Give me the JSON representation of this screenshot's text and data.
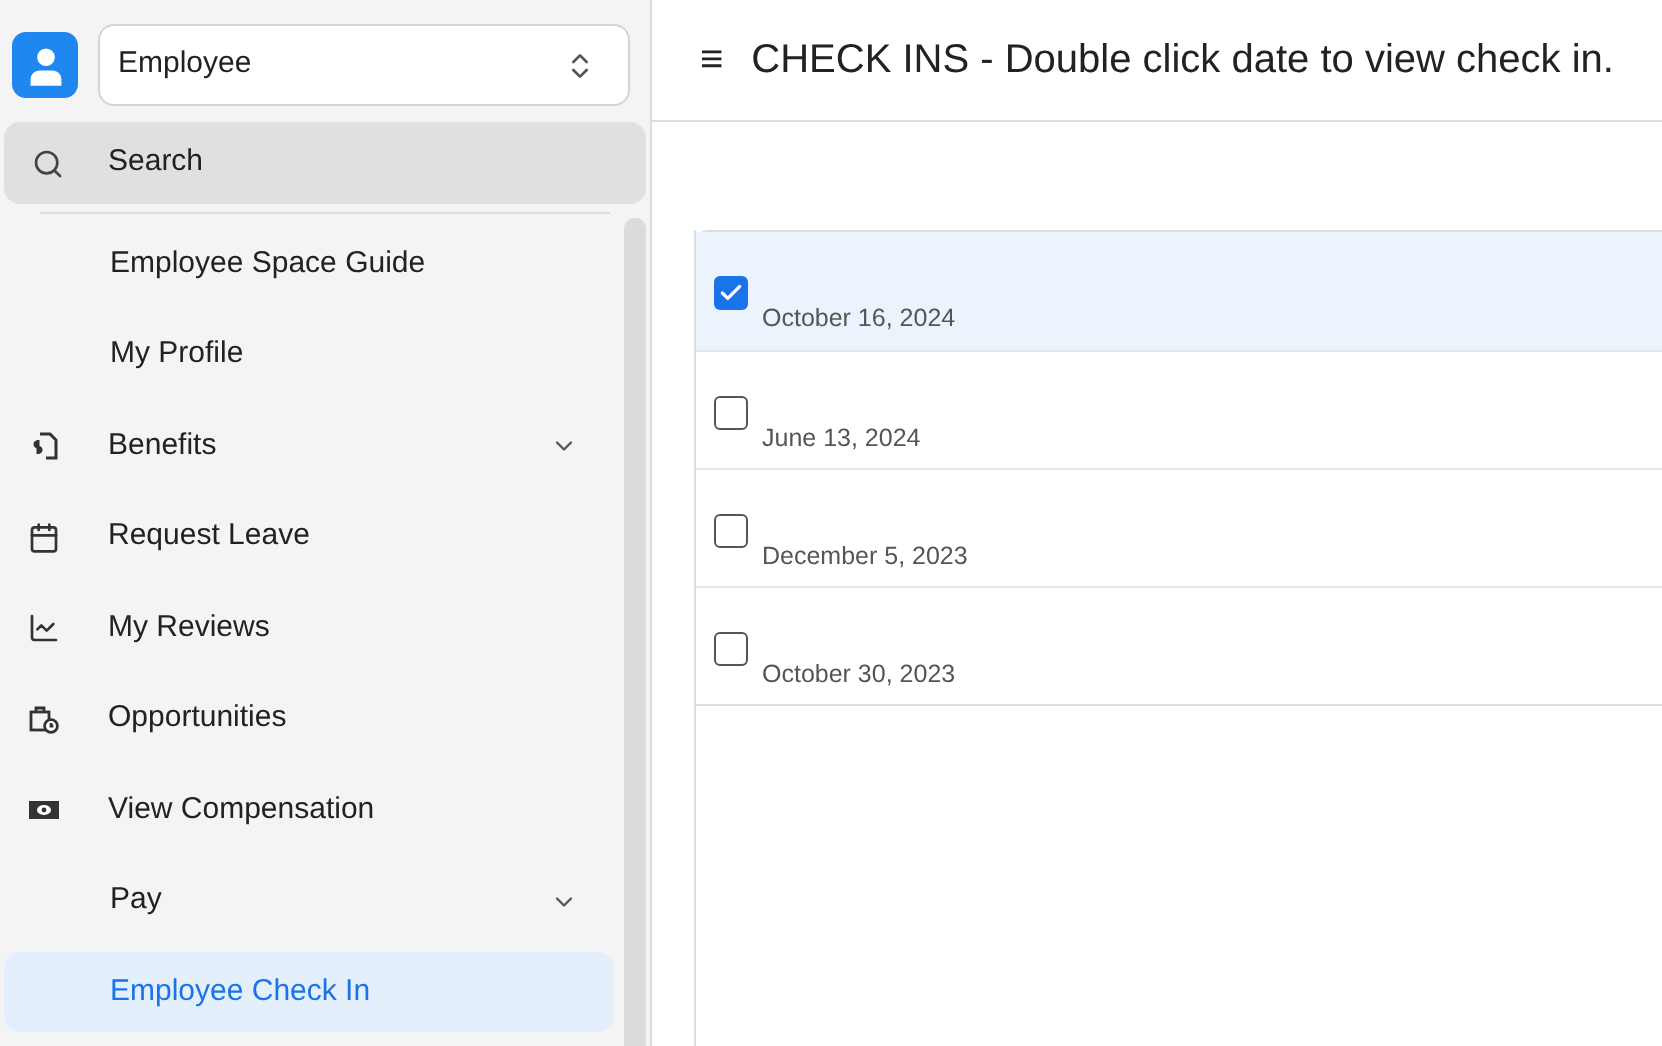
{
  "sidebar": {
    "switcher": {
      "value": "Employee"
    },
    "search": {
      "label": "Search"
    },
    "items": [
      {
        "label": "Employee Space Guide",
        "selected": false
      },
      {
        "label": "My Profile",
        "selected": false
      },
      {
        "label": "Benefits",
        "selected": false,
        "expanded": false
      },
      {
        "label": "Request Leave",
        "selected": false
      },
      {
        "label": "My Reviews",
        "selected": false
      },
      {
        "label": "Opportunities",
        "selected": false
      },
      {
        "label": "View Compensation",
        "selected": false
      },
      {
        "label": "Pay",
        "selected": false,
        "expanded": false
      },
      {
        "label": "Employee Check In",
        "selected": true
      }
    ]
  },
  "header": {
    "menu_glyph": "≡",
    "title": "CHECK INS - Double click date to view check in."
  },
  "checkins": [
    {
      "date": "October 16, 2024",
      "checked": true
    },
    {
      "date": "June 13, 2024",
      "checked": false
    },
    {
      "date": "December 5, 2023",
      "checked": false
    },
    {
      "date": "October 30, 2023",
      "checked": false
    }
  ]
}
